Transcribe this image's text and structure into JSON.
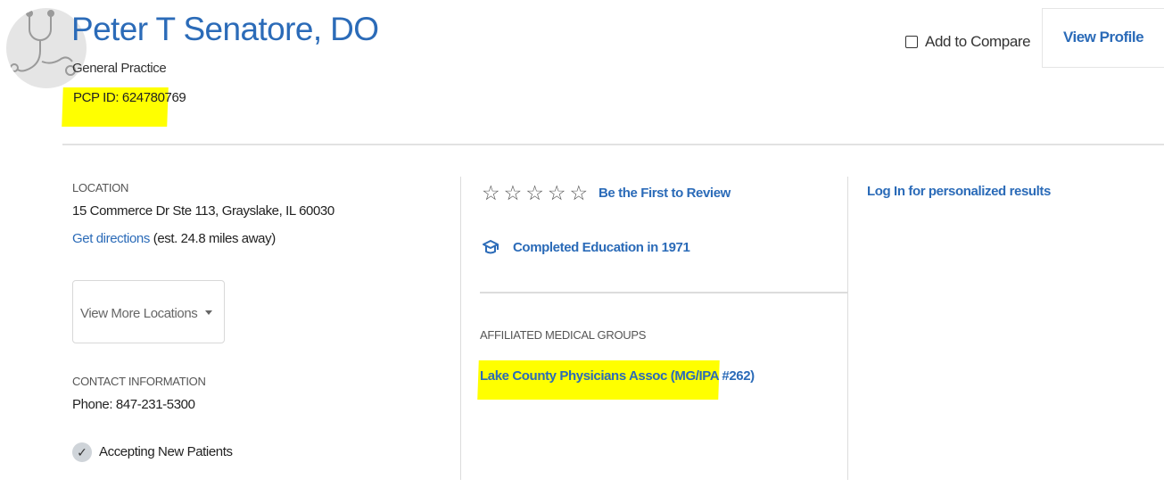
{
  "provider": {
    "name": "Peter T Senatore, DO",
    "specialty": "General Practice",
    "pcp_id": "PCP ID: 624780769"
  },
  "header": {
    "compare_label": "Add to Compare",
    "view_profile_label": "View Profile"
  },
  "location": {
    "label": "LOCATION",
    "address": "15 Commerce Dr Ste 113, Grayslake, IL 60030",
    "directions_link": "Get directions",
    "distance": "(est. 24.8 miles away)",
    "more_locations": "View More Locations"
  },
  "contact": {
    "label": "CONTACT INFORMATION",
    "phone": "Phone: 847-231-5300",
    "accepting": "Accepting New Patients"
  },
  "reviews": {
    "rating": 0,
    "max": 5,
    "link": "Be the First to Review"
  },
  "education": {
    "text": "Completed Education in 1971"
  },
  "affiliations": {
    "label": "AFFILIATED MEDICAL GROUPS",
    "groups": [
      "Lake County Physicians Assoc (MG/IPA #262)"
    ]
  },
  "sidebar": {
    "login_link": "Log In for personalized results"
  },
  "colors": {
    "link": "#2b6bb8",
    "highlight": "#ffff00",
    "divider": "#dcdcdc"
  }
}
